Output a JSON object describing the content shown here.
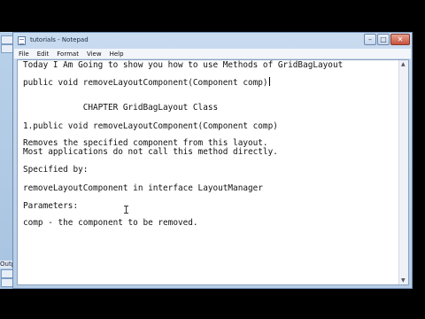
{
  "window": {
    "title": "tutorials - Notepad",
    "controls": {
      "minimize": "–",
      "maximize": "□",
      "close": "✕"
    }
  },
  "menu": [
    "File",
    "Edit",
    "Format",
    "View",
    "Help"
  ],
  "behind_window": {
    "label": "Outp"
  },
  "document": {
    "lines": [
      "Today I Am Going to show you how to use Methods of GridBagLayout",
      "public void removeLayoutComponent(Component comp)",
      "            CHAPTER GridBagLayout Class",
      "1.public void removeLayoutComponent(Component comp)",
      "Removes the specified component from this layout.",
      "Most applications do not call this method directly.",
      "Specified by:",
      "removeLayoutComponent in interface LayoutManager",
      "Parameters:",
      "comp - the component to be removed."
    ]
  },
  "icons": {
    "app": "notepad-icon",
    "cursor": "text-cursor-icon"
  }
}
